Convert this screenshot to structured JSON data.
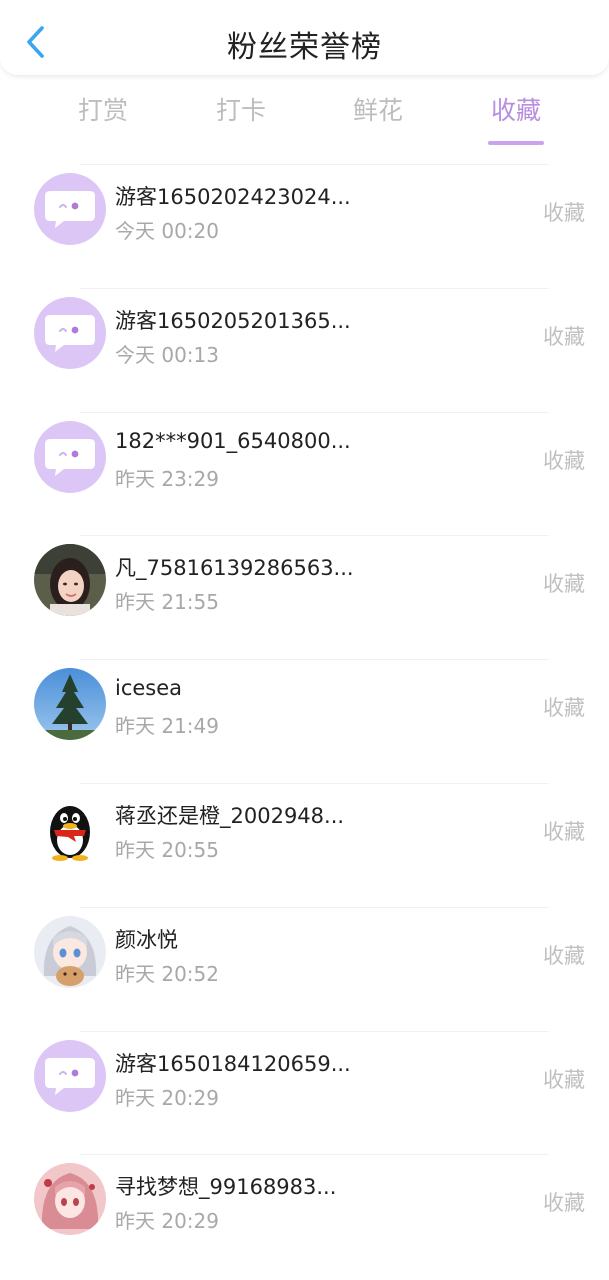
{
  "header": {
    "title": "粉丝荣誉榜"
  },
  "tabs": [
    {
      "label": "打赏",
      "active": false
    },
    {
      "label": "打卡",
      "active": false
    },
    {
      "label": "鲜花",
      "active": false
    },
    {
      "label": "收藏",
      "active": true
    }
  ],
  "colors": {
    "accent": "#b88ee0",
    "bubble_avatar": "#dcc6f6"
  },
  "fans": [
    {
      "name": "游客1650202423024...",
      "time": "今天 00:20",
      "action": "收藏",
      "avatar": "bubble-avatar-icon"
    },
    {
      "name": "游客1650205201365...",
      "time": "今天 00:13",
      "action": "收藏",
      "avatar": "bubble-avatar-icon"
    },
    {
      "name": "182***901_6540800...",
      "time": "昨天 23:29",
      "action": "收藏",
      "avatar": "bubble-avatar-icon"
    },
    {
      "name": "凡_75816139286563...",
      "time": "昨天 21:55",
      "action": "收藏",
      "avatar": "girl-photo-avatar"
    },
    {
      "name": "icesea",
      "time": "昨天 21:49",
      "action": "收藏",
      "avatar": "tree-sky-avatar"
    },
    {
      "name": "蒋丞还是橙_2002948...",
      "time": "昨天 20:55",
      "action": "收藏",
      "avatar": "penguin-avatar"
    },
    {
      "name": "颜冰悦",
      "time": "昨天 20:52",
      "action": "收藏",
      "avatar": "anime-girl-avatar"
    },
    {
      "name": "游客1650184120659...",
      "time": "昨天 20:29",
      "action": "收藏",
      "avatar": "bubble-avatar-icon"
    },
    {
      "name": "寻找梦想_99168983...",
      "time": "昨天 20:29",
      "action": "收藏",
      "avatar": "pink-anime-avatar"
    }
  ]
}
